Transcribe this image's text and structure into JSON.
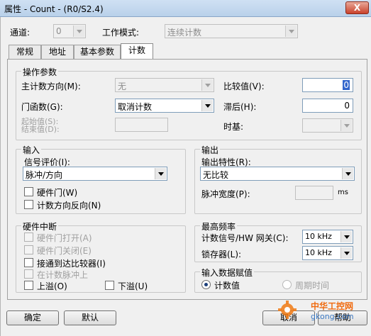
{
  "window": {
    "title": "属性 - Count - (R0/S2.4)",
    "close_glyph": "X"
  },
  "header": {
    "channel_label": "通道:",
    "channel_value": "0",
    "mode_label": "工作模式:",
    "mode_value": "连续计数"
  },
  "tabs": [
    {
      "label": "常规"
    },
    {
      "label": "地址"
    },
    {
      "label": "基本参数"
    },
    {
      "label": "计数"
    }
  ],
  "op_params": {
    "title": "操作参数",
    "main_dir_label": "主计数方向(M):",
    "main_dir_value": "无",
    "gate_label": "门函数(G):",
    "gate_value": "取消计数",
    "start_end_label_1": "起始值(S):",
    "start_end_label_2": "结束值(D):",
    "compare_label": "比较值(V):",
    "compare_value": "0",
    "delay_label": "滞后(H):",
    "delay_value": "0",
    "timebase_label": "时基:"
  },
  "input": {
    "title": "输入",
    "signal_label": "信号评价(I):",
    "signal_value": "脉冲/方向",
    "hw_gate_label": "硬件门(W)",
    "count_reverse_label": "计数方向反向(N)"
  },
  "output": {
    "title": "输出",
    "char_label": "输出特性(R):",
    "char_value": "无比较",
    "pulse_width_label": "脉冲宽度(P):",
    "pulse_width_unit": "ms"
  },
  "hw_interrupt": {
    "title": "硬件中断",
    "items": [
      {
        "label": "硬件门打开(A)",
        "disabled": true
      },
      {
        "label": "硬件门关闭(E)",
        "disabled": true
      },
      {
        "label": "接通到达比较器(I)",
        "disabled": false
      },
      {
        "label": "在计数脉冲上",
        "disabled": true
      }
    ],
    "overflow_label": "上溢(O)",
    "underflow_label": "下溢(U)"
  },
  "max_freq": {
    "title": "最高频率",
    "count_signal_label": "计数信号/HW 网关(C):",
    "count_signal_value": "10 kHz",
    "latch_label": "锁存器(L):",
    "latch_value": "10 kHz"
  },
  "input_value": {
    "title": "输入数据赋值",
    "count_value_label": "计数值",
    "period_label": "周期时间"
  },
  "buttons": {
    "ok": "确定",
    "default": "默认",
    "cancel": "取消",
    "help": "帮助"
  },
  "watermark": {
    "main": "中华工控网",
    "sub": "gkong.com"
  },
  "colors": {
    "accent": "#1b3e7a",
    "watermark": "#f06a0e"
  }
}
